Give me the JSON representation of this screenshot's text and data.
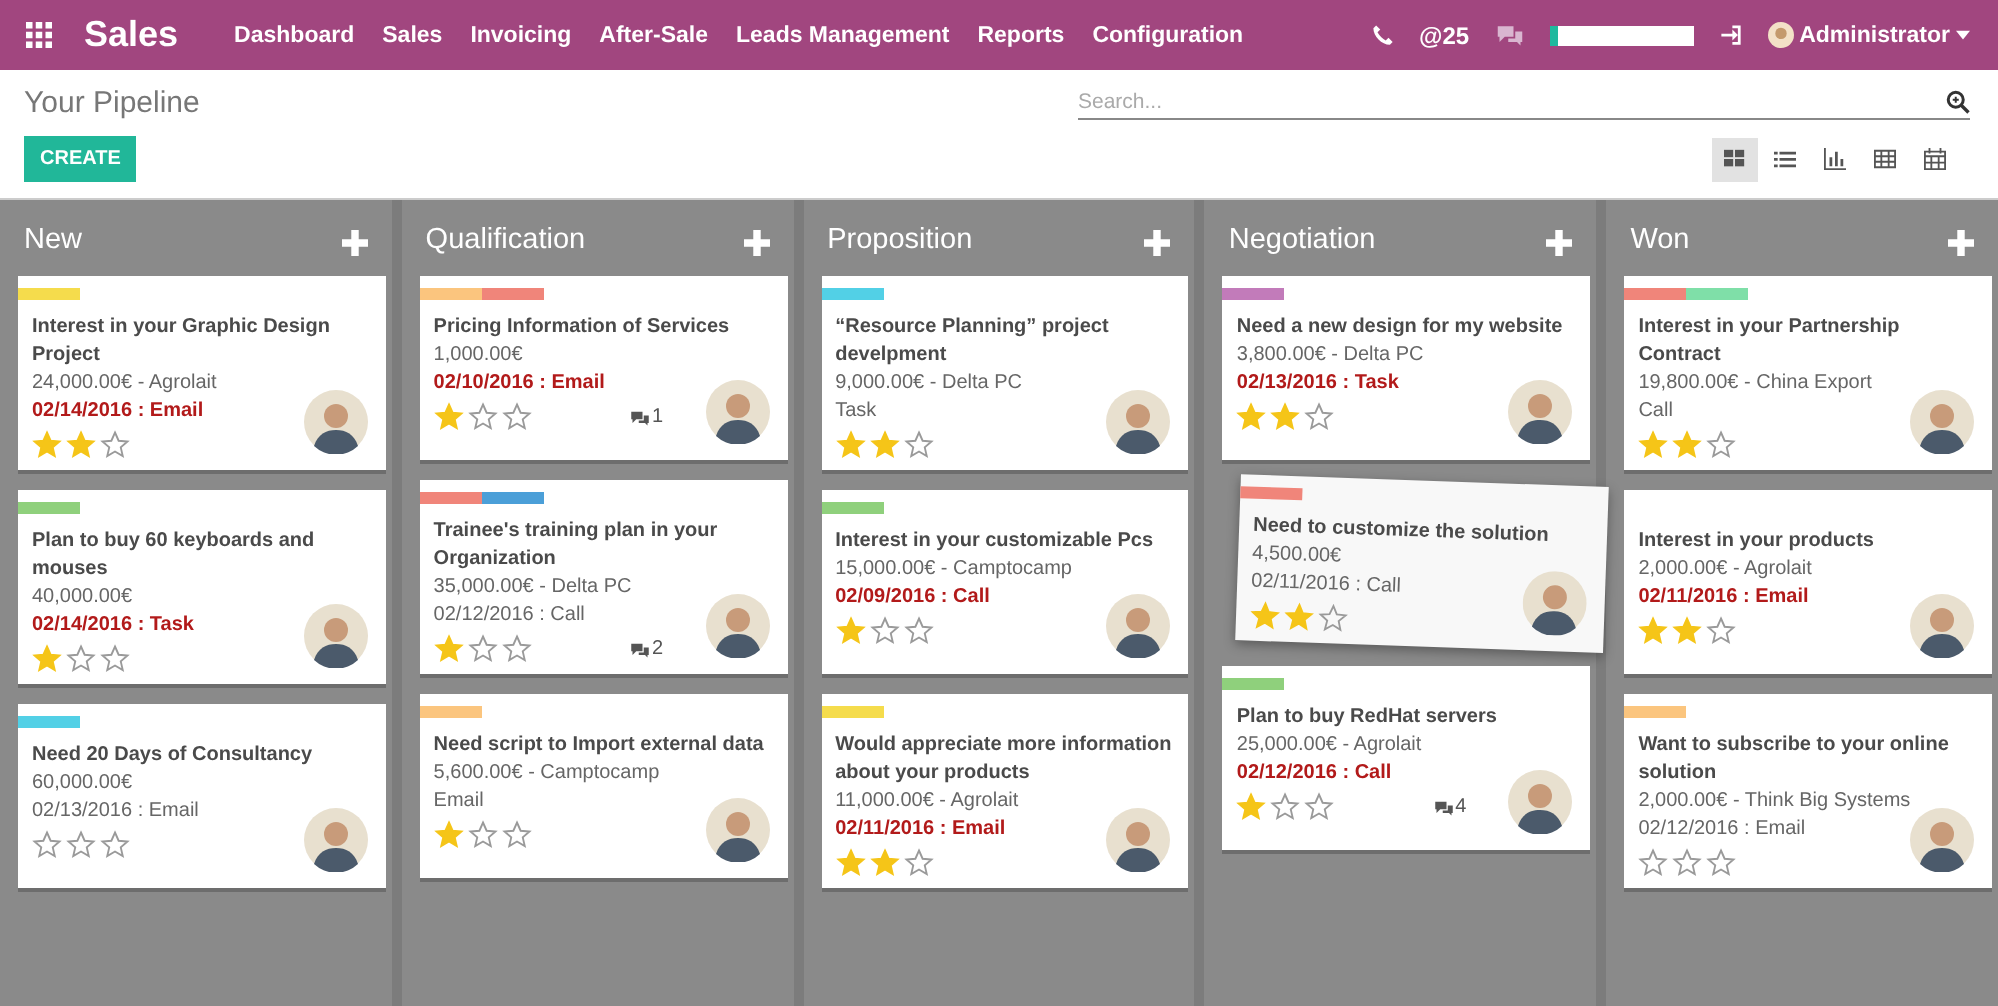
{
  "app": {
    "title": "Sales"
  },
  "menu": [
    "Dashboard",
    "Sales",
    "Invoicing",
    "After-Sale",
    "Leads Management",
    "Reports",
    "Configuration"
  ],
  "systray": {
    "mentions": "@25",
    "progress": {
      "level": 0.06
    },
    "user": "Administrator"
  },
  "breadcrumb": "Your Pipeline",
  "search": {
    "placeholder": "Search..."
  },
  "create_button": "CREATE",
  "views": [
    {
      "kind": "kanban",
      "selected": true
    },
    {
      "kind": "list",
      "selected": false
    },
    {
      "kind": "graph",
      "selected": false
    },
    {
      "kind": "pivot",
      "selected": false
    },
    {
      "kind": "calendar",
      "selected": false
    }
  ],
  "columns": [
    {
      "title": "New",
      "cards": [
        {
          "kind": "card",
          "tags": [
            {
              "color": "#f5dc4c"
            }
          ],
          "title": "Interest in your Graphic Design Project",
          "amount": "24,000.00€ - Agrolait",
          "activity": "02/14/2016 : Email",
          "overdue": true,
          "stars": 2
        },
        {
          "kind": "card",
          "tags": [
            {
              "color": "#8fd07c"
            }
          ],
          "title": "Plan to buy 60 keyboards and mouses",
          "amount": "40,000.00€",
          "activity": "02/14/2016 : Task",
          "overdue": true,
          "stars": 1
        },
        {
          "kind": "card",
          "tags": [
            {
              "color": "#52d0e6"
            }
          ],
          "title": "Need 20 Days of Consultancy",
          "amount": "60,000.00€",
          "activity": "02/13/2016 : Email",
          "overdue": false,
          "stars": 0
        }
      ]
    },
    {
      "title": "Qualification",
      "cards": [
        {
          "kind": "card",
          "tags": [
            {
              "color": "#fbc57e"
            },
            {
              "color": "#f0857a"
            }
          ],
          "title": "Pricing Information of Services",
          "amount": "1,000.00€",
          "activity": "02/10/2016 : Email",
          "overdue": true,
          "stars": 1,
          "messages": "1"
        },
        {
          "kind": "card",
          "tags": [
            {
              "color": "#f0857a"
            },
            {
              "color": "#4b9fd8"
            }
          ],
          "title": "Trainee's training plan in your Organization",
          "amount": "35,000.00€ - Delta PC",
          "activity": "02/12/2016 : Call",
          "overdue": false,
          "stars": 1,
          "messages": "2"
        },
        {
          "kind": "card",
          "tags": [
            {
              "color": "#fbc57e"
            }
          ],
          "title": "Need script to Import external data",
          "amount": "5,600.00€ - Camptocamp",
          "activity": "Email",
          "overdue": false,
          "stars": 1
        }
      ]
    },
    {
      "title": "Proposition",
      "cards": [
        {
          "kind": "card",
          "tags": [
            {
              "color": "#52d0e6"
            }
          ],
          "title": "“Resource Planning” project develpment",
          "amount": "9,000.00€ - Delta PC",
          "activity": "Task",
          "overdue": false,
          "stars": 2
        },
        {
          "kind": "card",
          "tags": [
            {
              "color": "#8fd07c"
            }
          ],
          "title": "Interest in your customizable Pcs",
          "amount": "15,000.00€ - Camptocamp",
          "activity": "02/09/2016 : Call",
          "overdue": true,
          "stars": 1
        },
        {
          "kind": "card",
          "tags": [
            {
              "color": "#f5dc4c"
            }
          ],
          "title": "Would appreciate more information about your products",
          "amount": "11,000.00€ - Agrolait",
          "activity": "02/11/2016 : Email",
          "overdue": true,
          "stars": 2
        }
      ]
    },
    {
      "title": "Negotiation",
      "cards": [
        {
          "kind": "card",
          "tags": [
            {
              "color": "#c27bba"
            }
          ],
          "title": "Need a new design for my website",
          "amount": "3,800.00€ - Delta PC",
          "activity": "02/13/2016 : Task",
          "overdue": true,
          "stars": 2
        },
        {
          "kind": "dragged",
          "tags": [
            {
              "color": "#f0857a"
            }
          ],
          "title": "Need to customize the solution",
          "amount": "4,500.00€",
          "activity": "02/11/2016 : Call",
          "overdue": false,
          "stars": 2
        },
        {
          "kind": "card",
          "tags": [
            {
              "color": "#8fd07c"
            }
          ],
          "title": "Plan to buy RedHat servers",
          "amount": "25,000.00€ - Agrolait",
          "activity": "02/12/2016 : Call",
          "overdue": true,
          "stars": 1,
          "messages": "4"
        }
      ]
    },
    {
      "title": "Won",
      "cards": [
        {
          "kind": "card",
          "tags": [
            {
              "color": "#f0857a"
            },
            {
              "color": "#7fdfa8"
            }
          ],
          "title": "Interest in your Partnership Contract",
          "amount": "19,800.00€ - China Export",
          "activity": "Call",
          "overdue": false,
          "stars": 2
        },
        {
          "kind": "card",
          "title": "Interest in your products",
          "amount": "2,000.00€ - Agrolait",
          "activity": "02/11/2016 : Email",
          "overdue": true,
          "stars": 2
        },
        {
          "kind": "card",
          "tags": [
            {
              "color": "#fbc57e"
            }
          ],
          "title": "Want to subscribe to your online solution",
          "amount": "2,000.00€ - Think Big Systems",
          "activity": "02/12/2016 : Email",
          "overdue": false,
          "stars": 0
        }
      ]
    }
  ]
}
